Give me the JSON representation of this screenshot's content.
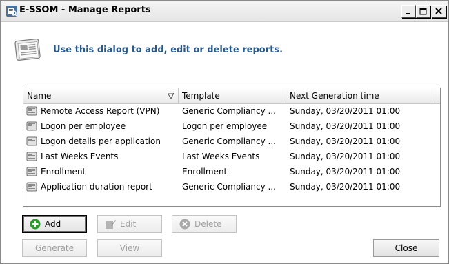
{
  "window": {
    "title": "E-SSOM - Manage Reports",
    "controls": {
      "minimize": "minimize",
      "maximize": "maximize",
      "close": "close"
    }
  },
  "header": {
    "instruction": "Use this dialog to add, edit or delete reports."
  },
  "list": {
    "columns": [
      "Name",
      "Template",
      "Next Generation time"
    ],
    "rows": [
      {
        "name": "Remote Access Report (VPN)",
        "template": "Generic Compliancy ...",
        "next": "Sunday, 03/20/2011 01:00"
      },
      {
        "name": "Logon per employee",
        "template": "Logon per employee",
        "next": "Sunday, 03/20/2011 01:00"
      },
      {
        "name": "Logon details per application",
        "template": "Generic Compliancy ...",
        "next": "Sunday, 03/20/2011 01:00"
      },
      {
        "name": "Last Weeks Events",
        "template": "Last Weeks Events",
        "next": "Sunday, 03/20/2011 01:00"
      },
      {
        "name": "Enrollment",
        "template": "Enrollment",
        "next": "Sunday, 03/20/2011 01:00"
      },
      {
        "name": "Application duration report",
        "template": "Generic Compliancy ...",
        "next": "Sunday, 03/20/2011 01:00"
      }
    ]
  },
  "buttons": {
    "add": "Add",
    "edit": "Edit",
    "delete": "Delete",
    "generate": "Generate",
    "view": "View",
    "close": "Close"
  },
  "colors": {
    "header_text": "#2a5a8a",
    "add_icon": "#2e9a2e",
    "disabled_text": "#a0a0a0"
  },
  "icons": {
    "app": "report-manager-icon",
    "header": "newspaper-icon",
    "row": "report-icon",
    "add": "plus-circle-icon",
    "edit": "edit-document-icon",
    "delete": "delete-circle-icon",
    "sort": "sort-filter-icon"
  }
}
